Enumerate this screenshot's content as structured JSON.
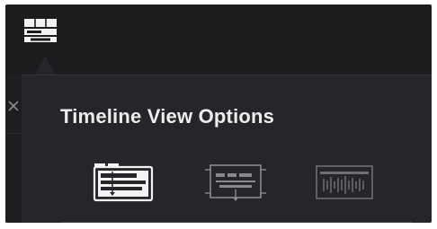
{
  "popover": {
    "title": "Timeline View Options"
  },
  "toolbar": {
    "button_icon": "timeline-view-options-icon"
  },
  "view_options": [
    {
      "icon": "stacked-timelines-icon",
      "selected": true
    },
    {
      "icon": "subtitle-tracks-icon",
      "selected": false
    },
    {
      "icon": "audio-waveform-icon",
      "selected": false
    }
  ],
  "colors": {
    "background": "#1c1c1e",
    "popover": "#26262a",
    "text": "#ededed",
    "icon_active": "#f2f2f2",
    "icon_inactive": "#8a8a8e"
  }
}
